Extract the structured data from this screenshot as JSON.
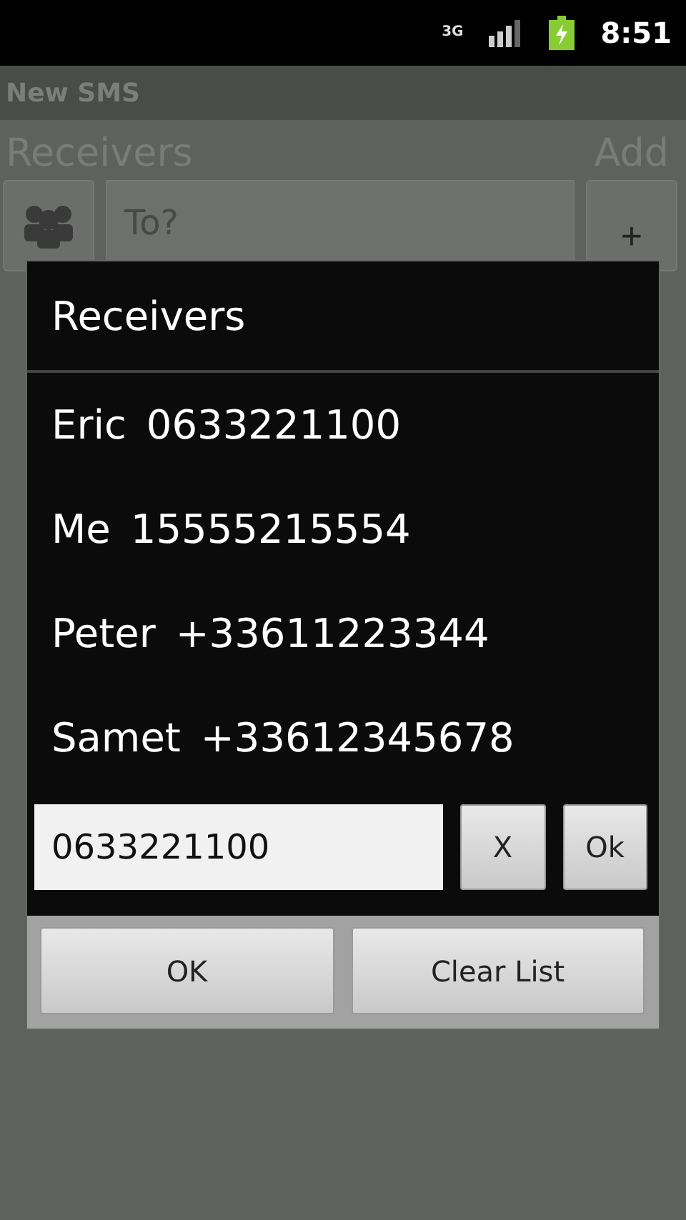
{
  "status_bar": {
    "time": "8:51",
    "network": "3G"
  },
  "app": {
    "title": "New SMS",
    "receivers_label": "Receivers",
    "add_label": "Add",
    "to_placeholder": "To?",
    "add_button": "+"
  },
  "dialog": {
    "title": "Receivers",
    "receivers": [
      {
        "name": "Eric",
        "number": "0633221100"
      },
      {
        "name": "Me",
        "number": "15555215554"
      },
      {
        "name": "Peter",
        "number": "+33611223344"
      },
      {
        "name": "Samet",
        "number": "+33612345678"
      }
    ],
    "number_field": {
      "value": "0633221100"
    },
    "clear_button": "X",
    "ok_small_button": "Ok",
    "buttons": [
      "OK",
      "Clear List"
    ]
  }
}
